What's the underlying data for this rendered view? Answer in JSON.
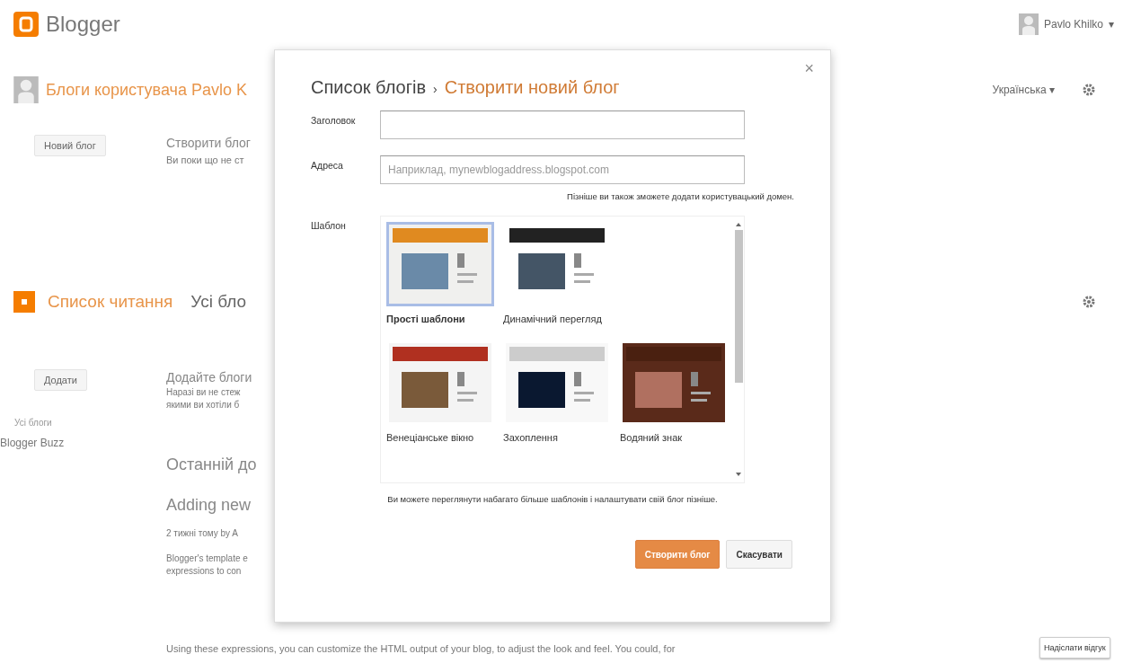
{
  "header": {
    "logo_text": "Blogger",
    "user_name": "Pavlo Khilko",
    "user_caret": "▾"
  },
  "blogs": {
    "title": "Блоги користувача Pavlo K",
    "language": "Українська",
    "language_caret": "▾",
    "new_blog_button": "Новий блог",
    "empty_title": "Створити блог",
    "empty_text": "Ви поки що не ст"
  },
  "reading_list": {
    "title": "Список читання",
    "tab": "Усі бло",
    "add_button": "Додати",
    "sidebar_heading": "Усі блоги",
    "sidebar_items": [
      "Blogger Buzz"
    ],
    "empty_title": "Додайте блоги",
    "empty_lines": [
      "Наразі ви не стеж",
      "якими ви хотіли б"
    ],
    "latest_heading": "Останній до",
    "post_title": "Adding new",
    "post_meta": "2 тижні тому by A",
    "post_lines": [
      "Blogger's template e",
      "expressions to con"
    ],
    "post_paragraph": "Using these expressions, you can customize the HTML output of your blog, to adjust the look and feel. You could, for"
  },
  "feedback_button": "Надіслати відгук",
  "dialog": {
    "close": "×",
    "breadcrumb": "Список блогів",
    "separator": "›",
    "title": "Створити новий блог",
    "fields": [
      {
        "label": "Заголовок"
      },
      {
        "label": "Адреса",
        "placeholder": "Наприклад, mynewblogaddress.blogspot.com"
      }
    ],
    "address_hint": "Пізніше ви також зможете додати користувацький домен.",
    "template_label": "Шаблон",
    "templates": [
      {
        "name": "Прості шаблони",
        "kind": "simple",
        "selected": true
      },
      {
        "name": "Динамічний перегляд",
        "kind": "dynamic",
        "selected": false
      },
      {
        "name": "Венеціанське вікно",
        "kind": "picture",
        "selected": false
      },
      {
        "name": "Захоплення",
        "kind": "awesome",
        "selected": false
      },
      {
        "name": "Водяний знак",
        "kind": "watermark",
        "selected": false
      }
    ],
    "templates_hint": "Ви можете переглянути набагато більше шаблонів і налаштувати свій блог пізніше.",
    "create_button": {
      "label": "Створити блог",
      "disabled": true
    },
    "cancel_button": {
      "label": "Скасувати",
      "disabled": false
    }
  }
}
